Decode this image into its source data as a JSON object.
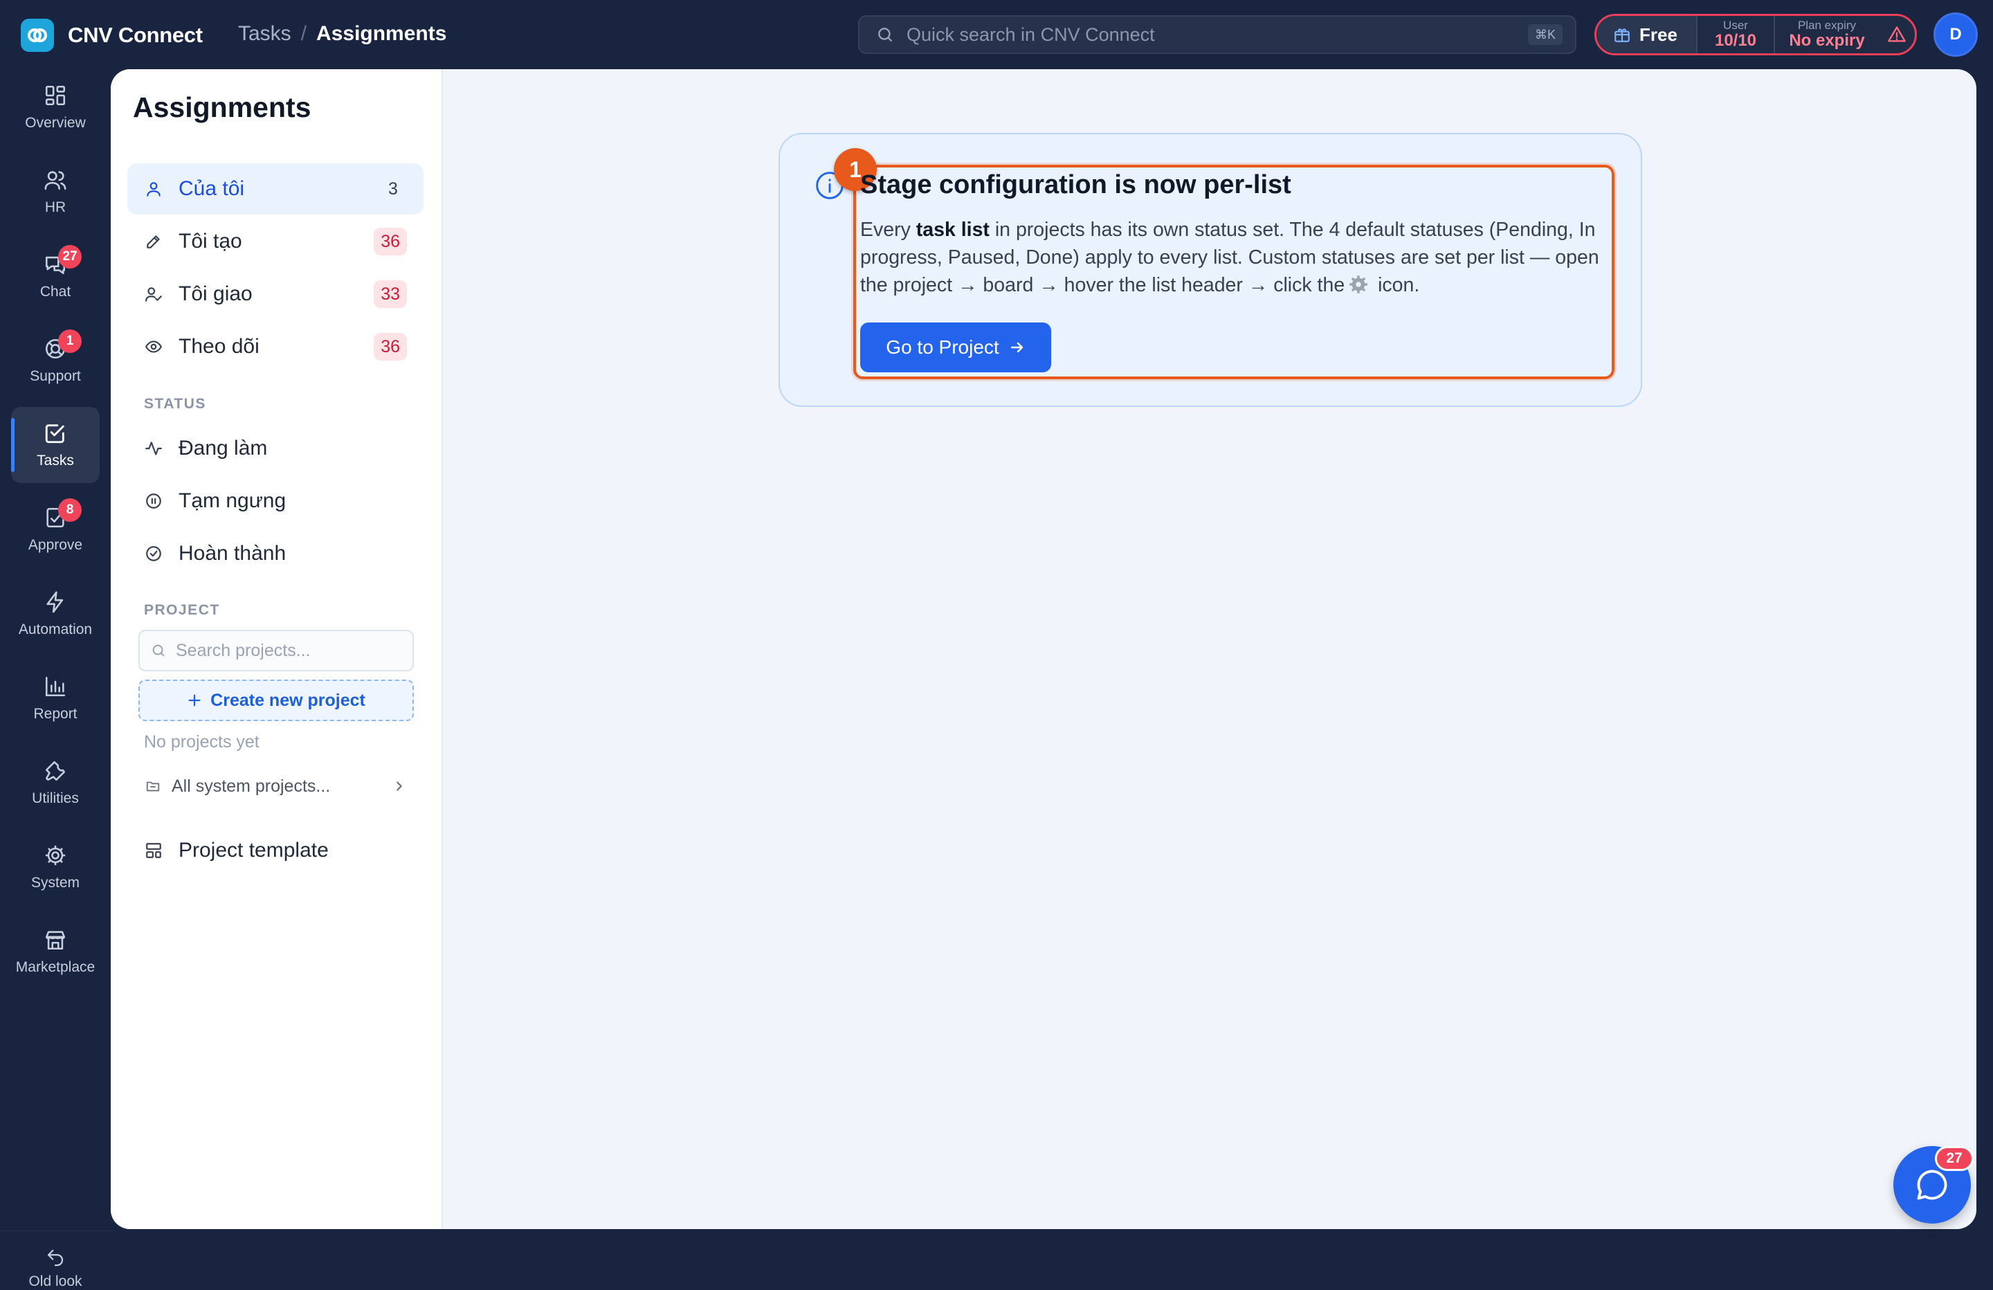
{
  "app": {
    "name": "CNV Connect"
  },
  "breadcrumb": {
    "parent": "Tasks",
    "separator": "/",
    "current": "Assignments"
  },
  "search": {
    "placeholder": "Quick search in CNV Connect",
    "shortcut": "⌘K"
  },
  "plan": {
    "name": "Free",
    "user_caption": "User",
    "user_value": "10/10",
    "expiry_caption": "Plan expiry",
    "expiry_value": "No expiry",
    "warning_icon": "warning-triangle-icon",
    "accent_color": "#ea3f58"
  },
  "avatar": {
    "initial": "D",
    "color": "#2463eb"
  },
  "rail": {
    "items": [
      {
        "label": "Overview",
        "icon": "grid-icon"
      },
      {
        "label": "HR",
        "icon": "users-icon"
      },
      {
        "label": "Chat",
        "icon": "chat-icon",
        "badge": "27"
      },
      {
        "label": "Support",
        "icon": "support-icon",
        "badge": "1"
      },
      {
        "label": "Tasks",
        "icon": "task-check-icon",
        "active": true
      },
      {
        "label": "Approve",
        "icon": "approve-icon",
        "badge": "8"
      },
      {
        "label": "Automation",
        "icon": "bolt-icon"
      },
      {
        "label": "Report",
        "icon": "bar-chart-icon"
      },
      {
        "label": "Utilities",
        "icon": "wrench-icon"
      },
      {
        "label": "System",
        "icon": "gear-icon"
      },
      {
        "label": "Marketplace",
        "icon": "store-icon"
      }
    ],
    "footer": {
      "label": "Old look",
      "icon": "undo-icon"
    }
  },
  "subnav": {
    "title": "Assignments",
    "views": [
      {
        "label": "Của tôi",
        "count": "3",
        "icon": "user-icon",
        "active": true
      },
      {
        "label": "Tôi tạo",
        "count": "36",
        "icon": "pencil-icon"
      },
      {
        "label": "Tôi giao",
        "count": "33",
        "icon": "user-check-icon"
      },
      {
        "label": "Theo dõi",
        "count": "36",
        "icon": "eye-icon"
      }
    ],
    "status_heading": "STATUS",
    "statuses": [
      {
        "label": "Đang làm",
        "icon": "activity-icon"
      },
      {
        "label": "Tạm ngưng",
        "icon": "pause-circle-icon"
      },
      {
        "label": "Hoàn thành",
        "icon": "check-circle-icon"
      }
    ],
    "project_heading": "PROJECT",
    "project_search_placeholder": "Search projects...",
    "create_project_label": "Create new project",
    "no_projects_text": "No projects yet",
    "all_projects_label": "All system projects...",
    "template_label": "Project template"
  },
  "announcement": {
    "step_number": "1",
    "title": "Stage configuration is now per-list",
    "body_prefix": "Every ",
    "body_bold": "task list",
    "body_middle": " in projects has its own status set. The 4 default statuses (Pending, In progress, Paused, Done) apply to every list. Custom statuses are set per list — open the project → board → hover the list header → click the",
    "body_suffix": " icon.",
    "button_label": "Go to Project",
    "highlight_color": "#e8591c"
  },
  "chat_fab": {
    "badge": "27"
  }
}
